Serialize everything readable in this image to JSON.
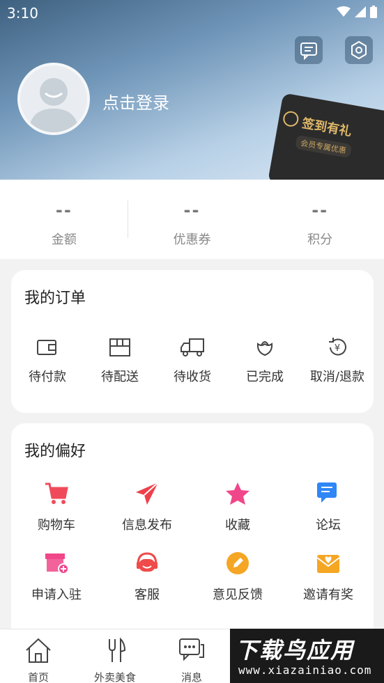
{
  "status_bar": {
    "time": "3:10"
  },
  "header": {
    "login_text": "点击登录",
    "message_icon": "message-icon",
    "settings_icon": "gear-icon",
    "sign_card": {
      "title": "签到有礼",
      "subtitle": "会员专属优惠"
    }
  },
  "stats": [
    {
      "value": "--",
      "label": "金额"
    },
    {
      "value": "--",
      "label": "优惠券"
    },
    {
      "value": "--",
      "label": "积分"
    }
  ],
  "orders": {
    "title": "我的订单",
    "items": [
      {
        "label": "待付款",
        "icon": "wallet-icon"
      },
      {
        "label": "待配送",
        "icon": "box-icon"
      },
      {
        "label": "待收货",
        "icon": "truck-icon"
      },
      {
        "label": "已完成",
        "icon": "flower-icon"
      },
      {
        "label": "取消/退款",
        "icon": "refund-icon"
      }
    ]
  },
  "preferences": {
    "title": "我的偏好",
    "items": [
      {
        "label": "购物车",
        "icon": "cart-icon",
        "color": "#f04a5a"
      },
      {
        "label": "信息发布",
        "icon": "send-icon",
        "color": "#ef3f4a"
      },
      {
        "label": "收藏",
        "icon": "star-icon",
        "color": "#f0468a"
      },
      {
        "label": "论坛",
        "icon": "chat-icon",
        "color": "#2f86f6"
      },
      {
        "label": "申请入驻",
        "icon": "shop-add-icon",
        "color": "#f0468a"
      },
      {
        "label": "客服",
        "icon": "headset-icon",
        "color": "#f04a4a"
      },
      {
        "label": "意见反馈",
        "icon": "pencil-icon",
        "color": "#f5a623"
      },
      {
        "label": "邀请有奖",
        "icon": "envelope-heart-icon",
        "color": "#f5a623"
      }
    ]
  },
  "tabbar": [
    {
      "label": "首页",
      "icon": "home-icon"
    },
    {
      "label": "外卖美食",
      "icon": "utensils-icon"
    },
    {
      "label": "消息",
      "icon": "message-icon"
    }
  ],
  "watermark": {
    "title": "下载鸟应用",
    "url": "www.xiazainiao.com"
  }
}
